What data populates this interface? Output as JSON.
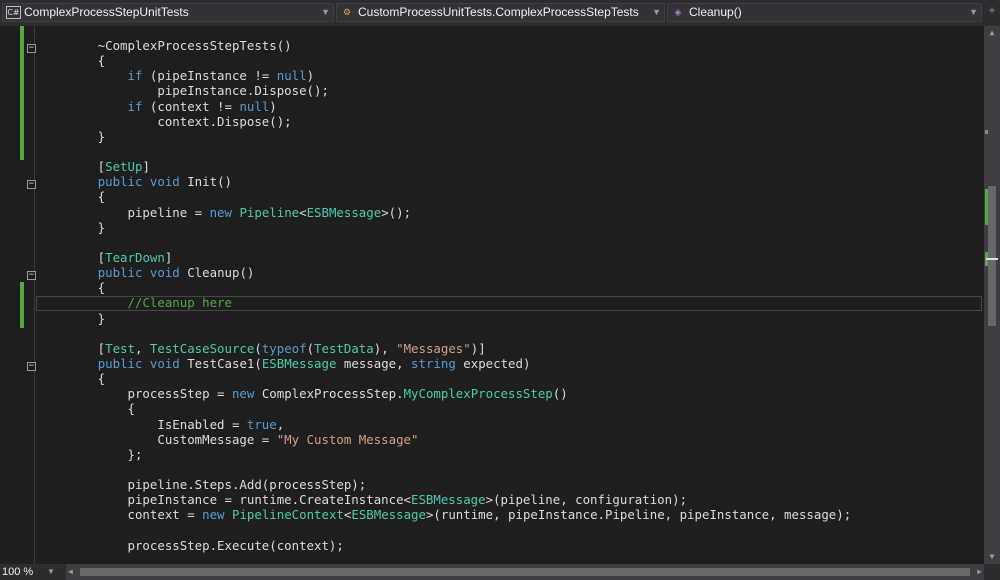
{
  "navbar": {
    "project": {
      "icon": "csharp-project-icon",
      "icon_text": "C#",
      "label": "ComplexProcessStepUnitTests"
    },
    "type": {
      "icon": "class-icon",
      "label": "CustomProcessUnitTests.ComplexProcessStepTests"
    },
    "member": {
      "icon": "method-icon",
      "label": "Cleanup()"
    }
  },
  "editor": {
    "lines": [
      [
        [
          "p",
          "        ~ComplexProcessStepTests()"
        ]
      ],
      [
        [
          "p",
          "        {"
        ]
      ],
      [
        [
          "p",
          "            "
        ],
        [
          "k",
          "if"
        ],
        [
          "p",
          " (pipeInstance != "
        ],
        [
          "k",
          "null"
        ],
        [
          "p",
          ")"
        ]
      ],
      [
        [
          "p",
          "                pipeInstance.Dispose();"
        ]
      ],
      [
        [
          "p",
          "            "
        ],
        [
          "k",
          "if"
        ],
        [
          "p",
          " (context != "
        ],
        [
          "k",
          "null"
        ],
        [
          "p",
          ")"
        ]
      ],
      [
        [
          "p",
          "                context.Dispose();"
        ]
      ],
      [
        [
          "p",
          "        }"
        ]
      ],
      [
        [
          "p",
          ""
        ]
      ],
      [
        [
          "p",
          "        ["
        ],
        [
          "t",
          "SetUp"
        ],
        [
          "p",
          "]"
        ]
      ],
      [
        [
          "p",
          "        "
        ],
        [
          "k",
          "public"
        ],
        [
          "p",
          " "
        ],
        [
          "k",
          "void"
        ],
        [
          "p",
          " Init()"
        ]
      ],
      [
        [
          "p",
          "        {"
        ]
      ],
      [
        [
          "p",
          "            pipeline = "
        ],
        [
          "k",
          "new"
        ],
        [
          "p",
          " "
        ],
        [
          "t",
          "Pipeline"
        ],
        [
          "p",
          "<"
        ],
        [
          "t",
          "ESBMessage"
        ],
        [
          "p",
          ">();"
        ]
      ],
      [
        [
          "p",
          "        }"
        ]
      ],
      [
        [
          "p",
          ""
        ]
      ],
      [
        [
          "p",
          "        ["
        ],
        [
          "t",
          "TearDown"
        ],
        [
          "p",
          "]"
        ]
      ],
      [
        [
          "p",
          "        "
        ],
        [
          "k",
          "public"
        ],
        [
          "p",
          " "
        ],
        [
          "k",
          "void"
        ],
        [
          "p",
          " Cleanup()"
        ]
      ],
      [
        [
          "p",
          "        {"
        ]
      ],
      [
        [
          "p",
          "            "
        ],
        [
          "c",
          "//Cleanup here"
        ]
      ],
      [
        [
          "p",
          "        }"
        ]
      ],
      [
        [
          "p",
          ""
        ]
      ],
      [
        [
          "p",
          "        ["
        ],
        [
          "t",
          "Test"
        ],
        [
          "p",
          ", "
        ],
        [
          "t",
          "TestCaseSource"
        ],
        [
          "p",
          "("
        ],
        [
          "k",
          "typeof"
        ],
        [
          "p",
          "("
        ],
        [
          "t",
          "TestData"
        ],
        [
          "p",
          "), "
        ],
        [
          "s",
          "\"Messages\""
        ],
        [
          "p",
          ")]"
        ]
      ],
      [
        [
          "p",
          "        "
        ],
        [
          "k",
          "public"
        ],
        [
          "p",
          " "
        ],
        [
          "k",
          "void"
        ],
        [
          "p",
          " TestCase1("
        ],
        [
          "t",
          "ESBMessage"
        ],
        [
          "p",
          " message, "
        ],
        [
          "k",
          "string"
        ],
        [
          "p",
          " expected)"
        ]
      ],
      [
        [
          "p",
          "        {"
        ]
      ],
      [
        [
          "p",
          "            processStep = "
        ],
        [
          "k",
          "new"
        ],
        [
          "p",
          " ComplexProcessStep."
        ],
        [
          "t",
          "MyComplexProcessStep"
        ],
        [
          "p",
          "()"
        ]
      ],
      [
        [
          "p",
          "            {"
        ]
      ],
      [
        [
          "p",
          "                IsEnabled = "
        ],
        [
          "k",
          "true"
        ],
        [
          "p",
          ","
        ]
      ],
      [
        [
          "p",
          "                CustomMessage = "
        ],
        [
          "s",
          "\"My Custom Message\""
        ]
      ],
      [
        [
          "p",
          "            };"
        ]
      ],
      [
        [
          "p",
          ""
        ]
      ],
      [
        [
          "p",
          "            pipeline.Steps.Add(processStep);"
        ]
      ],
      [
        [
          "p",
          "            pipeInstance = runtime.CreateInstance<"
        ],
        [
          "t",
          "ESBMessage"
        ],
        [
          "p",
          ">(pipeline, configuration);"
        ]
      ],
      [
        [
          "p",
          "            context = "
        ],
        [
          "k",
          "new"
        ],
        [
          "p",
          " "
        ],
        [
          "t",
          "PipelineContext"
        ],
        [
          "p",
          "<"
        ],
        [
          "t",
          "ESBMessage"
        ],
        [
          "p",
          ">(runtime, pipeInstance.Pipeline, pipeInstance, message);"
        ]
      ],
      [
        [
          "p",
          ""
        ]
      ],
      [
        [
          "p",
          "            processStep.Execute(context);"
        ]
      ]
    ],
    "folds": [
      "−",
      "−",
      "−",
      "−"
    ]
  },
  "statusbar": {
    "zoom": "100 %"
  },
  "colors": {
    "keyword": "#569cd6",
    "type": "#4ec9b0",
    "string": "#d69d85",
    "comment": "#57a64a",
    "changed": "#57a64a"
  }
}
